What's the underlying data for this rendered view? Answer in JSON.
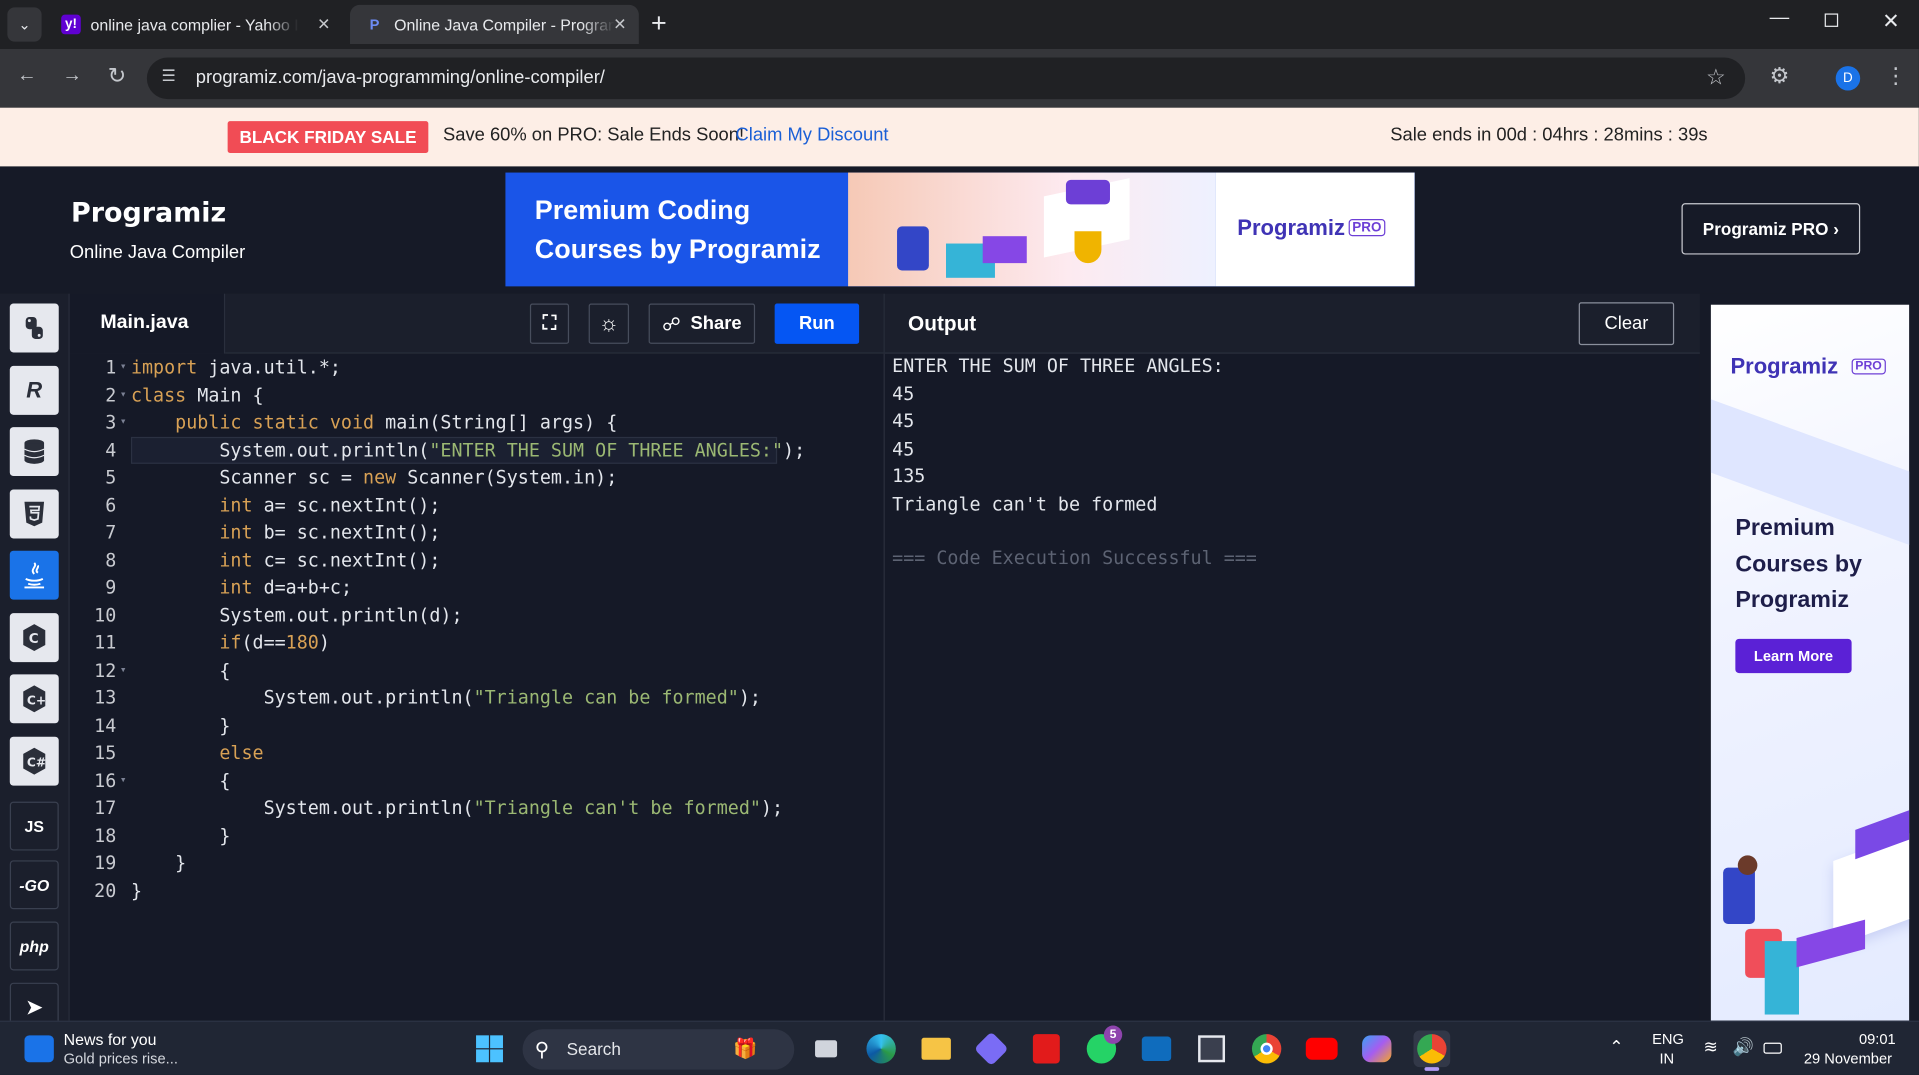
{
  "browser": {
    "tabs": [
      {
        "label": "online java complier - Yahoo Inq",
        "favicon": "y!"
      },
      {
        "label": "Online Java Compiler - Programiz",
        "favicon": "P"
      }
    ],
    "new_tab": "+",
    "url": "programiz.com/java-programming/online-compiler/",
    "profile": "D"
  },
  "promo": {
    "badge": "BLACK FRIDAY SALE",
    "text": "Save 60% on PRO: Sale Ends Soon!",
    "link": "Claim My Discount",
    "timer": "Sale ends in 00d : 04hrs : 28mins : 39s"
  },
  "header": {
    "logo": "Programiz",
    "subtitle": "Online Java Compiler",
    "ad_line1": "Premium Coding",
    "ad_line2": "Courses by Programiz",
    "ad_logo": "Programiz",
    "ad_pro": "PRO",
    "pro_button": "Programiz PRO ›"
  },
  "sidebar": {
    "langs": [
      "python-icon",
      "r-icon",
      "sql-icon",
      "html-icon",
      "java-icon",
      "c-icon",
      "cpp-icon",
      "csharp-icon",
      "js-icon",
      "go-icon",
      "php-icon",
      "swift-icon"
    ],
    "js": "JS",
    "go": "-GO",
    "php": "php"
  },
  "editor": {
    "filename": "Main.java",
    "share": "Share",
    "run": "Run",
    "lines": [
      {
        "n": "1",
        "fold": true,
        "html": "<span class='k'>import</span> java.util.*;"
      },
      {
        "n": "2",
        "fold": true,
        "html": "<span class='k'>class</span> Main {"
      },
      {
        "n": "3",
        "fold": true,
        "html": "    <span class='k'>public static void</span> main(String[] args) {"
      },
      {
        "n": "4",
        "fold": false,
        "html": "        System.out.println(<span class='s'>\"ENTER THE SUM OF THREE ANGLES:\"</span>);"
      },
      {
        "n": "5",
        "fold": false,
        "html": "        Scanner sc = <span class='k'>new</span> Scanner(System.in);"
      },
      {
        "n": "6",
        "fold": false,
        "html": "        <span class='k'>int</span> a= sc.nextInt();"
      },
      {
        "n": "7",
        "fold": false,
        "html": "        <span class='k'>int</span> b= sc.nextInt();"
      },
      {
        "n": "8",
        "fold": false,
        "html": "        <span class='k'>int</span> c= sc.nextInt();"
      },
      {
        "n": "9",
        "fold": false,
        "html": "        <span class='k'>int</span> d=a+b+c;"
      },
      {
        "n": "10",
        "fold": false,
        "html": "        System.out.println(d);"
      },
      {
        "n": "11",
        "fold": false,
        "html": "        <span class='k'>if</span>(d==<span class='n'>180</span>)"
      },
      {
        "n": "12",
        "fold": true,
        "html": "        {"
      },
      {
        "n": "13",
        "fold": false,
        "html": "            System.out.println(<span class='s'>\"Triangle can be formed\"</span>);"
      },
      {
        "n": "14",
        "fold": false,
        "html": "        }"
      },
      {
        "n": "15",
        "fold": false,
        "html": "        <span class='k'>else</span>"
      },
      {
        "n": "16",
        "fold": true,
        "html": "        {"
      },
      {
        "n": "17",
        "fold": false,
        "html": "            System.out.println(<span class='s'>\"Triangle can't be formed\"</span>);"
      },
      {
        "n": "18",
        "fold": false,
        "html": "        }"
      },
      {
        "n": "19",
        "fold": false,
        "html": "    }"
      },
      {
        "n": "20",
        "fold": false,
        "html": "}"
      }
    ]
  },
  "output": {
    "title": "Output",
    "clear": "Clear",
    "lines": [
      "ENTER THE SUM OF THREE ANGLES:",
      "45",
      "45",
      "45",
      "135",
      "Triangle can't be formed"
    ],
    "status": "=== Code Execution Successful ==="
  },
  "side_ad": {
    "logo": "Programiz",
    "pro": "PRO",
    "line1": "Premium",
    "line2": "Courses by",
    "line3": "Programiz",
    "cta": "Learn More"
  },
  "taskbar": {
    "news_title": "News for you",
    "news_sub": "Gold prices rise...",
    "search": "Search",
    "lang1": "ENG",
    "lang2": "IN",
    "time": "09:01",
    "date": "29 November",
    "whatsapp_badge": "5"
  }
}
